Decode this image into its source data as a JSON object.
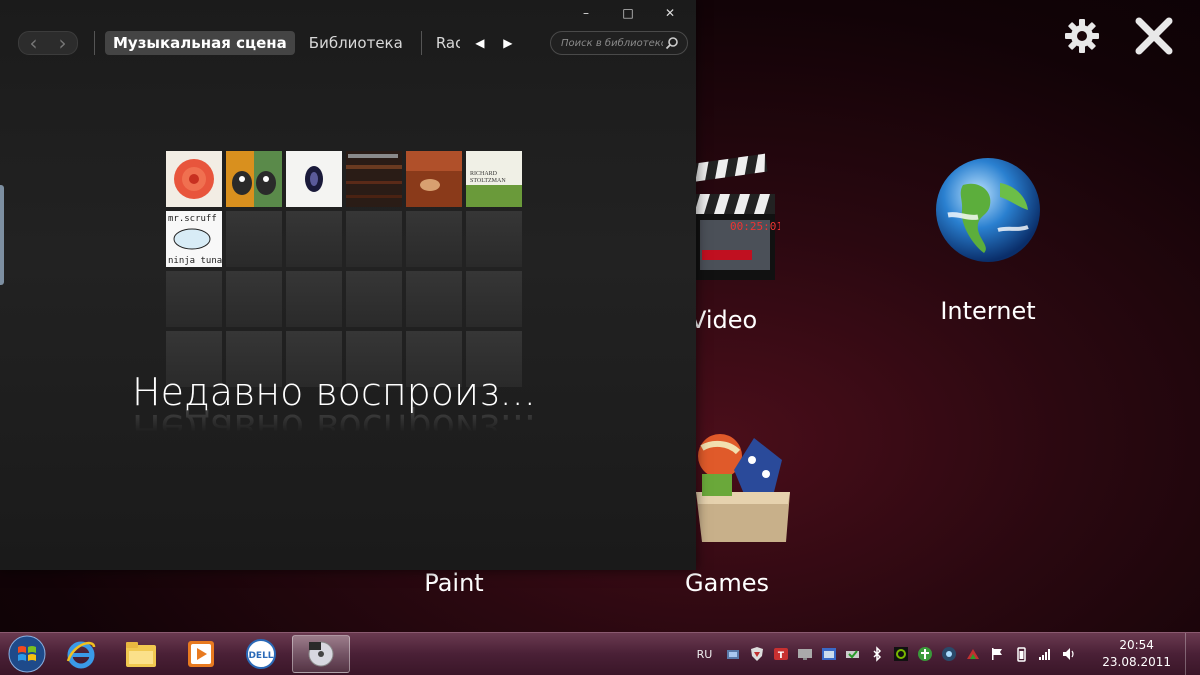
{
  "launcher": {
    "settings_icon": "gear-icon",
    "close_icon": "close-x-icon",
    "tiles": {
      "video": "Video",
      "internet": "Internet",
      "paint": "Paint",
      "games": "Games"
    }
  },
  "player": {
    "window_buttons": {
      "minimize": "–",
      "maximize": "□",
      "close": "✕"
    },
    "nav": {
      "back": "‹",
      "forward": "›",
      "pivots": [
        "Музыкальная сцена",
        "Библиотека",
        "Rac"
      ],
      "prev_arrow": "◀",
      "next_arrow": "▶"
    },
    "search": {
      "placeholder": "Поиск в библиотеке"
    },
    "section_title": "Недавно воспроиз...",
    "album_grid": {
      "albums": [
        {
          "cover": "red-flower-cover"
        },
        {
          "cover": "birds-orange-cover"
        },
        {
          "cover": "white-oval-cover"
        },
        {
          "cover": "dark-room-cover"
        },
        {
          "cover": "sepia-figure-cover"
        },
        {
          "cover": "richard-stoltzman-cover",
          "text": [
            "RICHARD",
            "STOLTZMAN"
          ]
        },
        {
          "cover": "mr-scruff-ninja-tuna-cover",
          "text": [
            "mr.scruff",
            "ninja tuna"
          ]
        }
      ],
      "rows": 4,
      "cols": 6
    }
  },
  "taskbar": {
    "start_icon": "windows-start-icon",
    "items": [
      "internet-explorer-icon",
      "file-explorer-icon",
      "media-player-icon",
      "dell-icon",
      "media-center-icon"
    ],
    "active_index": 4,
    "language": "RU",
    "tray_icons": [
      "network-icon",
      "shield-icon",
      "t-app-icon",
      "monitor-icon",
      "window-icon",
      "battery-check-icon",
      "bluetooth-icon",
      "nvidia-icon",
      "green-circle-icon",
      "eye-icon",
      "arrow-up-icon",
      "flag-icon",
      "battery-icon",
      "signal-icon",
      "volume-icon"
    ],
    "time": "20:54",
    "date": "23.08.2011"
  }
}
